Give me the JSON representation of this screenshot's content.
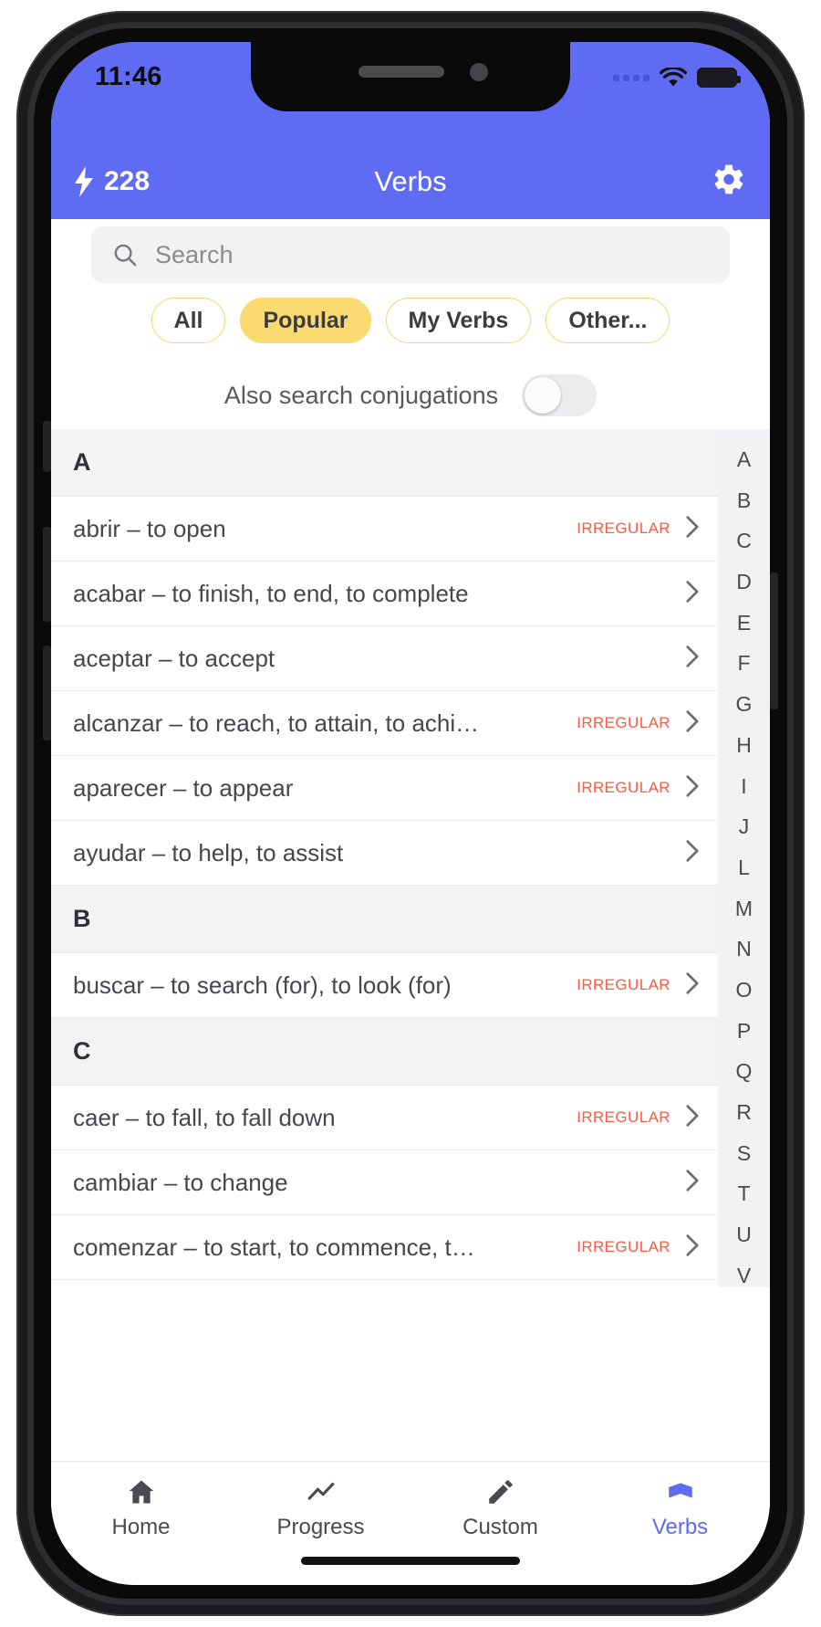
{
  "status_bar": {
    "time": "11:46",
    "signal_icon": "signal-dots-icon",
    "wifi_icon": "wifi-icon",
    "battery_icon": "battery-full-icon"
  },
  "nav_bar": {
    "streak_icon": "lightning-bolt-icon",
    "streak_count": "228",
    "title": "Verbs",
    "settings_icon": "gear-icon"
  },
  "search": {
    "icon": "search-icon",
    "placeholder": "Search",
    "value": ""
  },
  "filters": [
    {
      "label": "All",
      "active": false
    },
    {
      "label": "Popular",
      "active": true
    },
    {
      "label": "My Verbs",
      "active": false
    },
    {
      "label": "Other...",
      "active": false
    }
  ],
  "conjugation_toggle": {
    "label": "Also search conjugations",
    "state": "off"
  },
  "list": [
    {
      "type": "section",
      "letter": "A"
    },
    {
      "type": "row",
      "text": "abrir – to open",
      "tag": "IRREGULAR",
      "chevron": "chevron-right-icon"
    },
    {
      "type": "row",
      "text": "acabar – to finish, to end, to complete",
      "tag": "",
      "chevron": "chevron-right-icon"
    },
    {
      "type": "row",
      "text": "aceptar – to accept",
      "tag": "",
      "chevron": "chevron-right-icon"
    },
    {
      "type": "row",
      "text": "alcanzar – to reach, to attain, to achi…",
      "tag": "IRREGULAR",
      "chevron": "chevron-right-icon"
    },
    {
      "type": "row",
      "text": "aparecer – to appear",
      "tag": "IRREGULAR",
      "chevron": "chevron-right-icon"
    },
    {
      "type": "row",
      "text": "ayudar – to help, to assist",
      "tag": "",
      "chevron": "chevron-right-icon"
    },
    {
      "type": "section",
      "letter": "B"
    },
    {
      "type": "row",
      "text": "buscar – to search (for), to look (for)",
      "tag": "IRREGULAR",
      "chevron": "chevron-right-icon"
    },
    {
      "type": "section",
      "letter": "C"
    },
    {
      "type": "row",
      "text": "caer – to fall, to fall down",
      "tag": "IRREGULAR",
      "chevron": "chevron-right-icon"
    },
    {
      "type": "row",
      "text": "cambiar – to change",
      "tag": "",
      "chevron": "chevron-right-icon"
    },
    {
      "type": "row",
      "text": "comenzar – to start, to commence, t…",
      "tag": "IRREGULAR",
      "chevron": "chevron-right-icon"
    }
  ],
  "alpha_index": [
    "A",
    "B",
    "C",
    "D",
    "E",
    "F",
    "G",
    "H",
    "I",
    "J",
    "L",
    "M",
    "N",
    "O",
    "P",
    "Q",
    "R",
    "S",
    "T",
    "U",
    "V"
  ],
  "tab_bar": [
    {
      "label": "Home",
      "icon": "home-icon",
      "active": false
    },
    {
      "label": "Progress",
      "icon": "chart-line-icon",
      "active": false
    },
    {
      "label": "Custom",
      "icon": "pencil-icon",
      "active": false
    },
    {
      "label": "Verbs",
      "icon": "book-icon",
      "active": true
    }
  ],
  "colors": {
    "brand": "#5e6bf2",
    "chip_accent": "#fada71",
    "irregular": "#fb5a46"
  }
}
